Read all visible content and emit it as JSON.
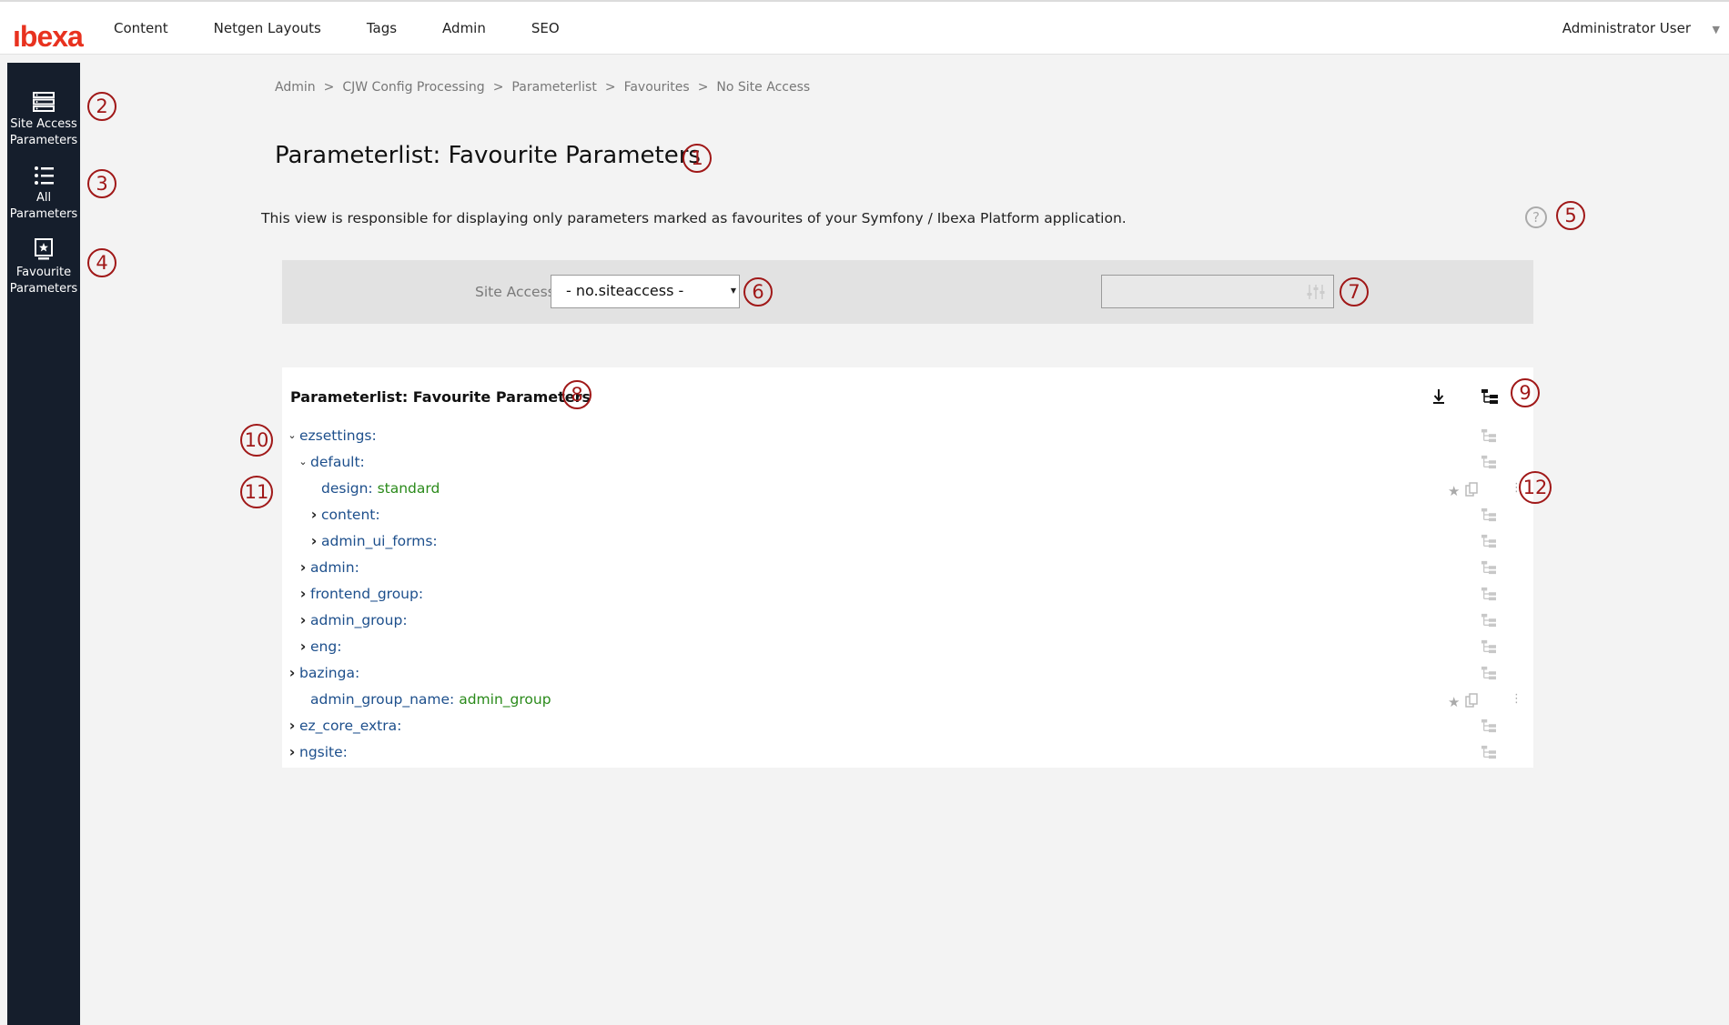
{
  "app": {
    "logo": "ıbexa"
  },
  "topnav": {
    "items": [
      {
        "label": "Content"
      },
      {
        "label": "Netgen Layouts"
      },
      {
        "label": "Tags"
      },
      {
        "label": "Admin"
      },
      {
        "label": "SEO"
      }
    ],
    "user": "Administrator User"
  },
  "sidebar": {
    "items": [
      {
        "label": "Site Access Parameters",
        "icon": "server-list-icon"
      },
      {
        "label": "All Parameters",
        "icon": "list-icon"
      },
      {
        "label": "Favourite Parameters",
        "icon": "bookmark-star-icon"
      }
    ]
  },
  "breadcrumb": [
    "Admin",
    "CJW Config Processing",
    "Parameterlist",
    "Favourites",
    "No Site Access"
  ],
  "page": {
    "title": "Parameterlist: Favourite Parameters",
    "description": "This view is responsible for displaying only parameters marked as favourites of your Symfony / Ibexa Platform application.",
    "help_icon": "?"
  },
  "filter": {
    "site_access_label": "Site Access:",
    "site_access_value": "- no.siteaccess -",
    "search_value": ""
  },
  "panel": {
    "title": "Parameterlist: Favourite Parameters",
    "tree": [
      {
        "key": "ezsettings:",
        "value": "",
        "level": 0,
        "toggle": "down"
      },
      {
        "key": "default:",
        "value": "",
        "level": 1,
        "toggle": "down"
      },
      {
        "key": "design: ",
        "value": "standard",
        "level": 2,
        "toggle": "none"
      },
      {
        "key": "content:",
        "value": "",
        "level": 2,
        "toggle": "right"
      },
      {
        "key": "admin_ui_forms:",
        "value": "",
        "level": 2,
        "toggle": "right"
      },
      {
        "key": "admin:",
        "value": "",
        "level": 1,
        "toggle": "right"
      },
      {
        "key": "frontend_group:",
        "value": "",
        "level": 1,
        "toggle": "right"
      },
      {
        "key": "admin_group:",
        "value": "",
        "level": 1,
        "toggle": "right"
      },
      {
        "key": "eng:",
        "value": "",
        "level": 1,
        "toggle": "right"
      },
      {
        "key": "bazinga:",
        "value": "",
        "level": 0,
        "toggle": "right"
      },
      {
        "key": "admin_group_name: ",
        "value": "admin_group",
        "level": 1,
        "toggle": "none"
      },
      {
        "key": "ez_core_extra:",
        "value": "",
        "level": 0,
        "toggle": "right"
      },
      {
        "key": "ngsite:",
        "value": "",
        "level": 0,
        "toggle": "right"
      }
    ]
  },
  "markers": [
    "1",
    "2",
    "3",
    "4",
    "5",
    "6",
    "7",
    "8",
    "9",
    "10",
    "11",
    "12"
  ],
  "colors": {
    "sidebar": "#151e2c",
    "brand": "#e8321f",
    "key": "#1d4f8c",
    "value": "#2a8a1a",
    "marker": "#a01818"
  }
}
